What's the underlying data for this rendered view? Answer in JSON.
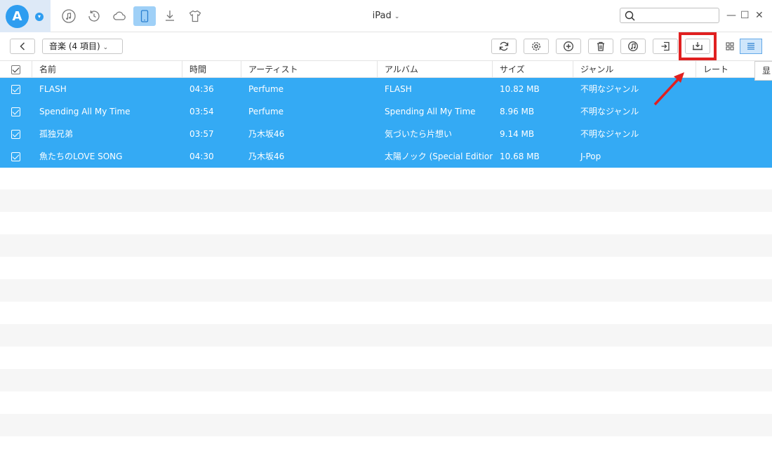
{
  "app": {
    "logo_letter": "A",
    "device_title": "iPad",
    "nav_icons": [
      "music-note-icon",
      "history-icon",
      "cloud-icon",
      "tablet-icon",
      "download-icon",
      "tshirt-icon"
    ],
    "active_nav": "tablet-icon",
    "window_controls": [
      "—",
      "☐",
      "✕"
    ]
  },
  "search": {
    "placeholder": ""
  },
  "toolbar": {
    "category_label": "音楽 (4 項目)",
    "buttons": [
      "refresh-icon",
      "settings-icon",
      "add-icon",
      "delete-icon",
      "itunes-icon",
      "export-icon",
      "to-computer-icon"
    ],
    "view_modes": [
      "grid-view-icon",
      "list-view-icon"
    ],
    "active_view": "list-view-icon"
  },
  "table": {
    "columns": [
      "名前",
      "時間",
      "アーティスト",
      "アルバム",
      "サイズ",
      "ジャンル",
      "レート"
    ],
    "rows": [
      {
        "name": "FLASH",
        "time": "04:36",
        "artist": "Perfume",
        "album": "FLASH",
        "size": "10.82 MB",
        "genre": "不明なジャンル"
      },
      {
        "name": "Spending All My Time",
        "time": "03:54",
        "artist": "Perfume",
        "album": "Spending All My Time",
        "size": "8.96 MB",
        "genre": "不明なジャンル"
      },
      {
        "name": "孤独兄弟",
        "time": "03:57",
        "artist": "乃木坂46",
        "album": "気づいたら片想い",
        "size": "9.14 MB",
        "genre": "不明なジャンル"
      },
      {
        "name": "魚たちのLOVE SONG",
        "time": "04:30",
        "artist": "乃木坂46",
        "album": "太陽ノック (Special Edition)",
        "size": "10.68 MB",
        "genre": "J-Pop"
      }
    ]
  },
  "tooltip": {
    "text": "显示"
  },
  "colors": {
    "selected_row": "#34aaf4",
    "highlight": "#e02020",
    "accent": "#2e9df0"
  }
}
